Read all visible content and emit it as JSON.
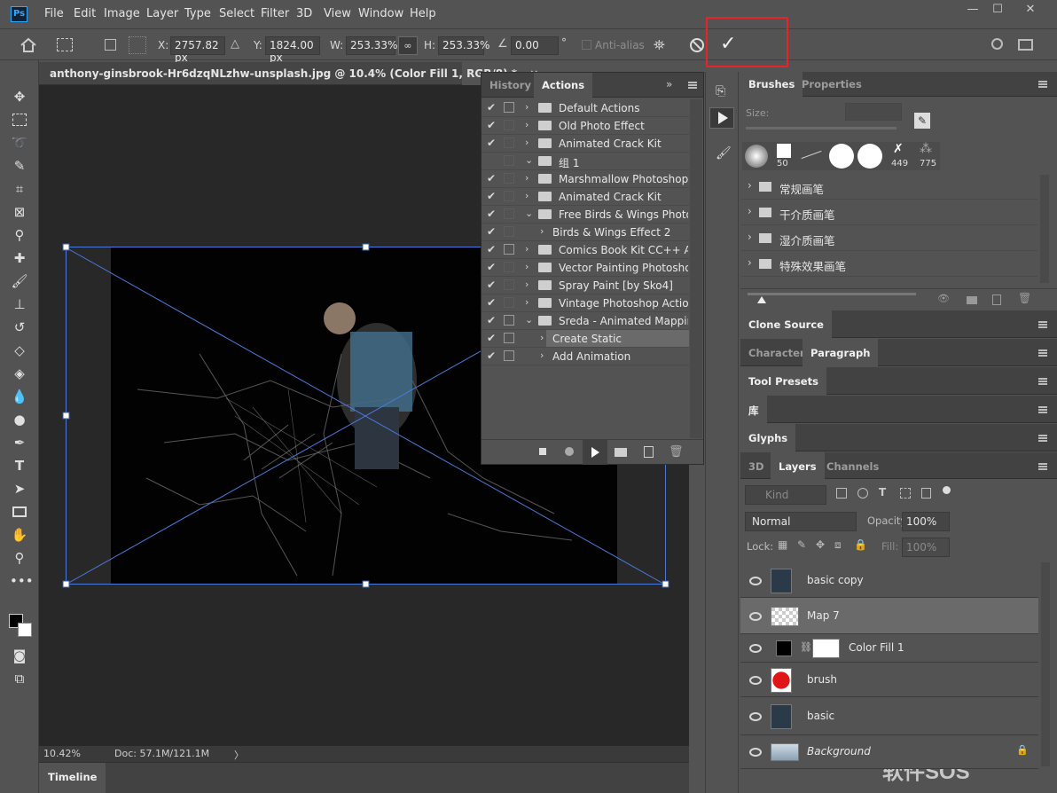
{
  "app": {
    "logo": "Ps"
  },
  "menu": [
    "File",
    "Edit",
    "Image",
    "Layer",
    "Type",
    "Select",
    "Filter",
    "3D",
    "View",
    "Window",
    "Help"
  ],
  "window_controls": {
    "minimize": "—",
    "maximize": "☐",
    "close": "✕"
  },
  "options": {
    "x_label": "X:",
    "x_value": "2757.82 px",
    "y_label": "Y:",
    "y_value": "1824.00 px",
    "w_label": "W:",
    "w_value": "253.33%",
    "h_label": "H:",
    "h_value": "253.33%",
    "angle_value": "0.00",
    "angle_unit": "°",
    "antialias": "Anti-alias"
  },
  "document": {
    "tab_title": "anthony-ginsbrook-Hr6dzqNLzhw-unsplash.jpg @ 10.4% (Color Fill 1, RGB/8) *",
    "close": "×",
    "zoom": "10.42%",
    "doc_size": "Doc: 57.1M/121.1M",
    "status_arrow": "〉"
  },
  "timeline": {
    "label": "Timeline"
  },
  "actions_panel": {
    "tabs": [
      "History",
      "Actions"
    ],
    "active_tab": "Actions",
    "rows": [
      {
        "label": "Default Actions",
        "checked": true,
        "box": true,
        "expanded": false,
        "indent": 0
      },
      {
        "label": "Old Photo Effect",
        "checked": true,
        "box": false,
        "expanded": false,
        "indent": 0
      },
      {
        "label": "Animated Crack Kit",
        "checked": true,
        "box": false,
        "expanded": false,
        "indent": 0
      },
      {
        "label": "组 1",
        "checked": false,
        "box": false,
        "expanded": true,
        "indent": 0
      },
      {
        "label": "Marshmallow Photoshop A...",
        "checked": true,
        "box": false,
        "expanded": false,
        "indent": 0
      },
      {
        "label": "Animated Crack Kit",
        "checked": true,
        "box": false,
        "expanded": false,
        "indent": 0
      },
      {
        "label": "Free Birds & Wings Photos...",
        "checked": true,
        "box": false,
        "expanded": true,
        "indent": 0
      },
      {
        "label": "Birds & Wings Effect 2",
        "checked": true,
        "box": false,
        "expanded": false,
        "indent": 1
      },
      {
        "label": "Comics Book Kit CC++ Act...",
        "checked": true,
        "box": true,
        "expanded": false,
        "indent": 0
      },
      {
        "label": "Vector Painting Photoshop...",
        "checked": true,
        "box": false,
        "expanded": false,
        "indent": 0
      },
      {
        "label": "Spray Paint [by Sko4]",
        "checked": true,
        "box": false,
        "expanded": false,
        "indent": 0
      },
      {
        "label": "Vintage Photoshop Actions",
        "checked": true,
        "box": false,
        "expanded": false,
        "indent": 0
      },
      {
        "label": "Sreda - Animated Mapping",
        "checked": true,
        "box": true,
        "expanded": true,
        "indent": 0
      },
      {
        "label": "Create Static",
        "checked": true,
        "box": true,
        "expanded": false,
        "indent": 1,
        "selected": true
      },
      {
        "label": "Add Animation",
        "checked": true,
        "box": true,
        "expanded": false,
        "indent": 1
      }
    ]
  },
  "brushes_panel": {
    "tabs": [
      "Brushes",
      "Properties"
    ],
    "size_label": "Size:",
    "presets": [
      "50",
      "449",
      "775"
    ],
    "groups": [
      "常规画笔",
      "干介质画笔",
      "湿介质画笔",
      "特殊效果画笔"
    ]
  },
  "collapsed_panels": {
    "clone_source": "Clone Source",
    "character": "Character",
    "paragraph": "Paragraph",
    "tool_presets": "Tool Presets",
    "library": "库",
    "glyphs": "Glyphs"
  },
  "layers_panel": {
    "tabs": [
      "3D",
      "Layers",
      "Channels"
    ],
    "kind": "Kind",
    "blend_mode": "Normal",
    "opacity_label": "Opacity:",
    "opacity": "100%",
    "lock_label": "Lock:",
    "fill_label": "Fill:",
    "fill": "100%",
    "layers": [
      {
        "name": "basic copy",
        "thumb": "photo",
        "selected": false
      },
      {
        "name": "Map 7",
        "thumb": "transparent",
        "selected": true
      },
      {
        "name": "Color Fill 1",
        "thumb": "fill",
        "selected": false
      },
      {
        "name": "brush",
        "thumb": "red",
        "selected": false
      },
      {
        "name": "basic",
        "thumb": "photo",
        "selected": false
      },
      {
        "name": "Background",
        "thumb": "bg",
        "selected": false
      }
    ]
  },
  "watermark": "软件SOS",
  "colors": {
    "accent_red": "#e8232b",
    "transform_box": "#4a7bdc",
    "panel": "#535353",
    "dark": "#282828"
  }
}
